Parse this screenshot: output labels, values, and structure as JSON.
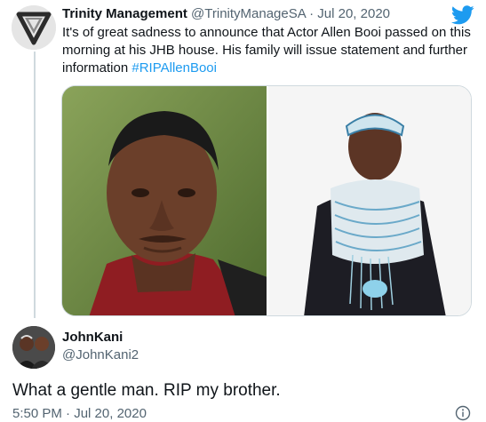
{
  "quoted_tweet": {
    "name": "Trinity Management",
    "handle": "@TrinityManageSA",
    "separator": " · ",
    "date": "Jul 20, 2020",
    "text": "It's of great sadness to announce that Actor Allen Booi passed on this morning at his JHB house. His family will issue statement and further information ",
    "hashtag": "#RIPAllenBooi",
    "avatar_icon": "trinity-logo-icon",
    "brand_icon": "twitter-bird-icon",
    "colors": {
      "link": "#1d9bf0",
      "secondary": "#536471",
      "primary": "#0f1419"
    }
  },
  "media": {
    "photo_left": "portrait-photo",
    "photo_right": "traditional-attire-photo"
  },
  "reply": {
    "name": "JohnKani",
    "handle": "@JohnKani2",
    "text": "What a gentle man. RIP my brother.",
    "time": "5:50 PM",
    "separator": " · ",
    "date": "Jul 20, 2020",
    "info_icon": "info-icon"
  }
}
